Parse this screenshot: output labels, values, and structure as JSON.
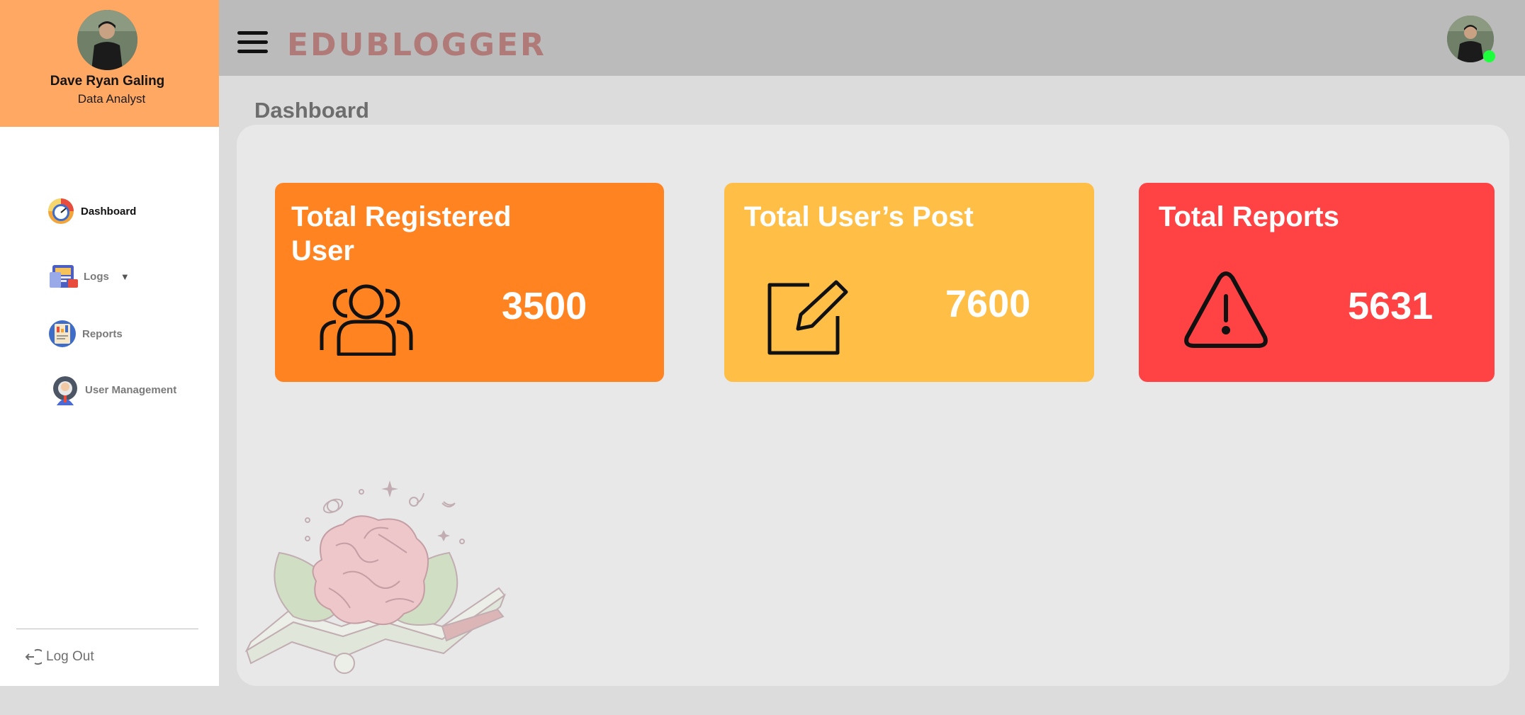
{
  "user": {
    "name": "Dave Ryan Galing",
    "role": "Data Analyst"
  },
  "nav": {
    "items": [
      {
        "label": "Dashboard",
        "icon": "dashboard-gauge-icon",
        "active": true
      },
      {
        "label": "Logs",
        "icon": "logs-icon",
        "has_dropdown": true
      },
      {
        "label": "Reports",
        "icon": "reports-icon"
      },
      {
        "label": "User Management",
        "icon": "user-management-icon"
      }
    ],
    "logout_label": "Log Out"
  },
  "header": {
    "brand": "EDUBLOGGER",
    "online_status_color": "#1dff3c"
  },
  "page": {
    "title": "Dashboard"
  },
  "cards": {
    "users": {
      "title_line1": "Total Registered",
      "title_line2": "User",
      "value": "3500",
      "icon": "users-group-icon",
      "color": "#ff8421"
    },
    "posts": {
      "title": "Total User’s Post",
      "value": "7600",
      "icon": "edit-square-icon",
      "color": "#ffbe45"
    },
    "reports": {
      "title": "Total Reports",
      "value": "5631",
      "icon": "warning-triangle-icon",
      "color": "#ff4244"
    }
  },
  "colors": {
    "sidebar_header": "#ffa864",
    "topbar": "#bbbbbb",
    "brand_text": "#b07a78"
  }
}
